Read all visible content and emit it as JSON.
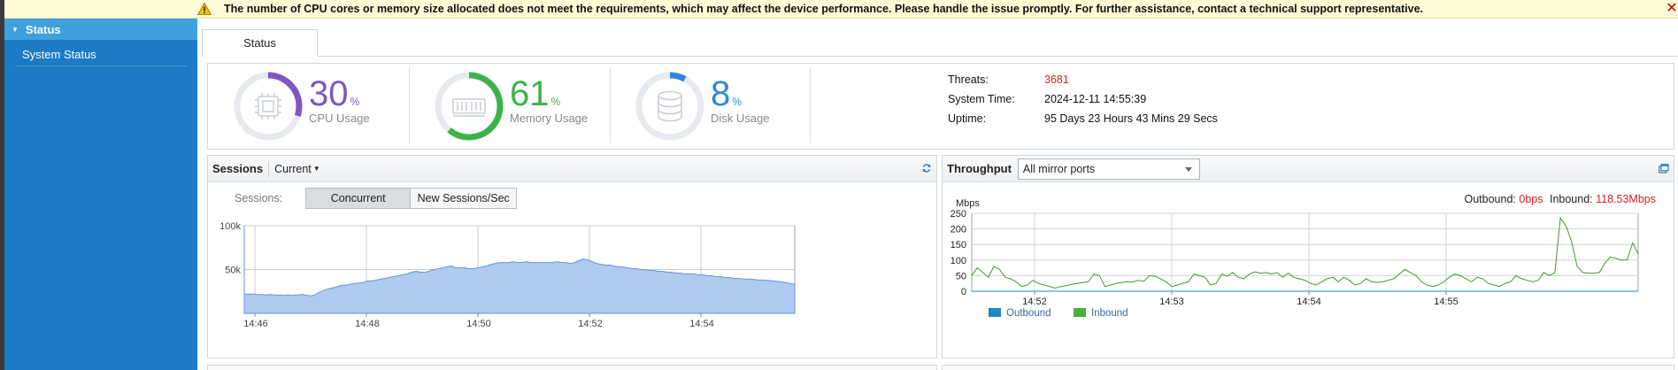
{
  "banner": {
    "message": "The number of CPU cores or memory size allocated does not meet the requirements, which may affect the device performance. Please handle the issue promptly. For further assistance, contact a technical support representative.",
    "close_glyph": "✕"
  },
  "sidebar": {
    "section_label": "Status",
    "items": [
      {
        "label": "System Status"
      }
    ]
  },
  "tabs": [
    {
      "label": "Status"
    }
  ],
  "stats": {
    "cpu": {
      "value": "30",
      "unit": "%",
      "label": "CPU Usage",
      "percent": 30,
      "color": "#7e57c2"
    },
    "memory": {
      "value": "61",
      "unit": "%",
      "label": "Memory Usage",
      "percent": 61,
      "color": "#3cb34a"
    },
    "disk": {
      "value": "8",
      "unit": "%",
      "label": "Disk Usage",
      "percent": 8,
      "color": "#2f86e0"
    }
  },
  "info": {
    "threats_label": "Threats:",
    "threats_value": "3681",
    "threats_color": "#e02020",
    "system_time_label": "System Time:",
    "system_time_value": "2024-12-11 14:55:39",
    "uptime_label": "Uptime:",
    "uptime_value": "95 Days 23 Hours 43 Mins 29 Secs"
  },
  "sessions": {
    "title": "Sessions",
    "range_dropdown": "Current",
    "segment_label": "Sessions:",
    "segments": [
      {
        "label": "Concurrent",
        "active": true
      },
      {
        "label": "New Sessions/Sec",
        "active": false
      }
    ]
  },
  "throughput": {
    "title": "Throughput",
    "port_select": "All mirror ports",
    "outbound_label": "Outbound:",
    "outbound_value": "0bps",
    "inbound_label": "Inbound:",
    "inbound_value": "118.53Mbps",
    "value_color": "#e02020"
  },
  "chart_data": [
    {
      "type": "area",
      "series": [
        {
          "values": [
            22000,
            22000,
            22000,
            21500,
            21500,
            21000,
            21500,
            21000,
            21000,
            20500,
            21000,
            20500,
            21000,
            21500,
            21000,
            20000,
            21000,
            24000,
            26000,
            28000,
            29000,
            30000,
            32000,
            32000,
            33000,
            34000,
            34500,
            35000,
            37000,
            37000,
            38000,
            39000,
            40000,
            41000,
            42000,
            43000,
            44000,
            45000,
            47000,
            48000,
            47000,
            47000,
            48000,
            50000,
            51000,
            52000,
            53000,
            54000,
            52000,
            52000,
            52000,
            51000,
            51000,
            52000,
            53000,
            54000,
            56000,
            57000,
            58000,
            58000,
            58000,
            59000,
            58000,
            58000,
            59000,
            58000,
            58000,
            58000,
            58000,
            58000,
            58000,
            59000,
            58000,
            58000,
            57000,
            58000,
            60000,
            62000,
            61000,
            59000,
            57000,
            56000,
            55000,
            55000,
            54000,
            53000,
            53000,
            52000,
            51000,
            51000,
            50000,
            50000,
            49000,
            49000,
            48000,
            48000,
            47000,
            47000,
            46000,
            46000,
            45000,
            45000,
            45000,
            44000,
            44000,
            43000,
            43000,
            42000,
            42000,
            41000,
            41000,
            40000,
            40000,
            39500,
            39000,
            39000,
            38500,
            38000,
            38000,
            37500,
            37000,
            36500,
            36000,
            35000,
            34000,
            33000
          ],
          "color": "#aecbf0"
        }
      ],
      "x_ticks": [
        "14:46",
        "14:48",
        "14:50",
        "14:52",
        "14:54"
      ],
      "y_ticks": [
        "100k",
        "50k"
      ],
      "ylim": [
        0,
        100000
      ],
      "grid": true
    },
    {
      "type": "line",
      "ylabel": "Mbps",
      "y_ticks": [
        250,
        200,
        150,
        100,
        50,
        0
      ],
      "ylim": [
        0,
        250
      ],
      "x_ticks": [
        "14:52",
        "14:53",
        "14:54",
        "14:55"
      ],
      "grid": true,
      "legend": [
        {
          "name": "Outbound",
          "color": "#1f86c8"
        },
        {
          "name": "Inbound",
          "color": "#4caf3a"
        }
      ],
      "series": [
        {
          "name": "Outbound",
          "values": [
            0,
            0,
            0,
            0,
            0,
            0,
            0,
            0,
            0,
            0,
            0,
            0,
            0,
            0,
            0,
            0,
            0,
            0,
            0,
            0,
            0,
            0,
            0,
            0,
            0,
            0,
            0,
            0,
            0,
            0,
            0,
            0,
            0,
            0,
            0,
            0,
            0,
            0,
            0,
            0,
            0,
            0,
            0,
            0,
            0,
            0,
            0,
            0,
            0,
            0,
            0,
            0,
            0,
            0,
            0,
            0,
            0,
            0,
            0,
            0,
            0,
            0,
            0,
            0,
            0,
            0,
            0,
            0,
            0,
            0,
            0,
            0,
            0,
            0,
            0,
            0,
            0,
            0,
            0,
            0,
            0,
            0,
            0,
            0,
            0,
            0,
            0,
            0,
            0,
            0,
            0,
            0,
            0,
            0,
            0,
            0,
            0,
            0,
            0,
            0,
            0,
            0,
            0,
            0,
            0,
            0,
            0,
            0,
            0
          ],
          "color": "#1f86c8"
        },
        {
          "name": "Inbound",
          "values": [
            50,
            75,
            60,
            45,
            80,
            70,
            45,
            40,
            30,
            15,
            20,
            35,
            25,
            20,
            15,
            10,
            15,
            18,
            22,
            25,
            28,
            30,
            55,
            50,
            15,
            20,
            25,
            28,
            30,
            30,
            35,
            32,
            50,
            48,
            40,
            30,
            15,
            20,
            25,
            30,
            55,
            50,
            45,
            20,
            25,
            55,
            48,
            60,
            45,
            40,
            55,
            62,
            58,
            60,
            55,
            60,
            45,
            58,
            45,
            40,
            35,
            25,
            20,
            30,
            40,
            45,
            30,
            45,
            35,
            20,
            25,
            40,
            30,
            28,
            30,
            35,
            40,
            55,
            70,
            60,
            50,
            30,
            20,
            15,
            20,
            30,
            45,
            55,
            50,
            40,
            30,
            45,
            40,
            25,
            20,
            15,
            25,
            30,
            50,
            40,
            35,
            30,
            35,
            60,
            50,
            60,
            235,
            210,
            160,
            80,
            60,
            58,
            58,
            60,
            90,
            110,
            105,
            100,
            100,
            155,
            120
          ],
          "color": "#3e9a2a"
        }
      ]
    }
  ]
}
